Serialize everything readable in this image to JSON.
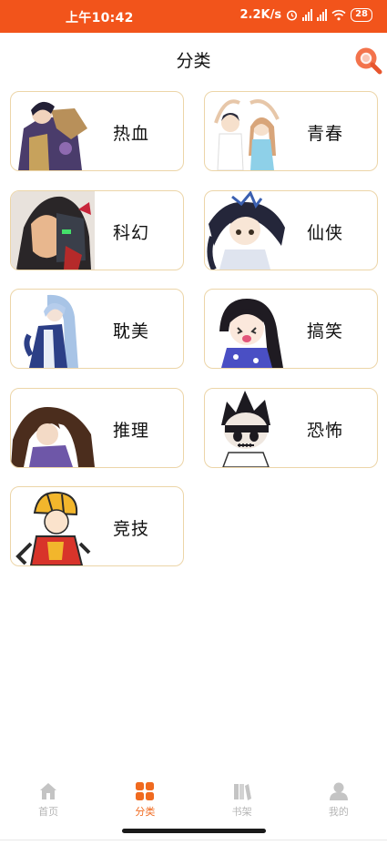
{
  "status_bar": {
    "time": "上午10:42",
    "speed": "2.2K/s",
    "battery": "28",
    "background": "#f2541b"
  },
  "header": {
    "title": "分类",
    "search_icon": "search-icon",
    "accent": "#f06a1f"
  },
  "categories": [
    {
      "label": "热血",
      "icon": "hot-blooded-art"
    },
    {
      "label": "青春",
      "icon": "youth-art"
    },
    {
      "label": "科幻",
      "icon": "sci-fi-art"
    },
    {
      "label": "仙侠",
      "icon": "xianxia-art"
    },
    {
      "label": "耽美",
      "icon": "danmei-art"
    },
    {
      "label": "搞笑",
      "icon": "comedy-art"
    },
    {
      "label": "推理",
      "icon": "mystery-art"
    },
    {
      "label": "恐怖",
      "icon": "horror-art"
    },
    {
      "label": "竞技",
      "icon": "sports-art"
    }
  ],
  "tabbar": {
    "active": "分类",
    "items": [
      {
        "label": "首页",
        "icon": "home-icon"
      },
      {
        "label": "分类",
        "icon": "grid-icon"
      },
      {
        "label": "书架",
        "icon": "bookshelf-icon"
      },
      {
        "label": "我的",
        "icon": "profile-icon"
      }
    ]
  }
}
